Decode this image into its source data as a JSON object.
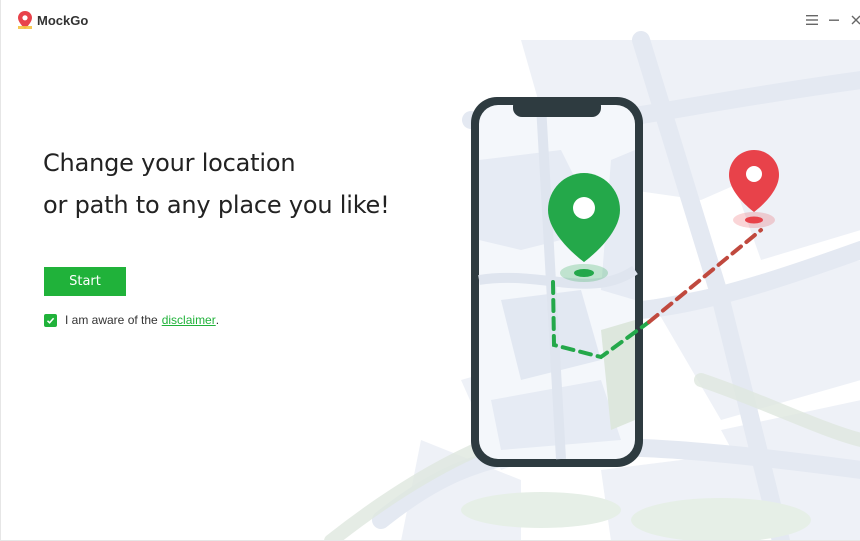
{
  "app": {
    "title": "MockGo"
  },
  "window_controls": {
    "menu_icon": "menu-icon",
    "minimize_icon": "minimize-icon",
    "close_icon": "close-icon"
  },
  "hero": {
    "line1": "Change your location",
    "line2": "or path to any place you like!"
  },
  "actions": {
    "start_label": "Start"
  },
  "disclaimer": {
    "checked": true,
    "prefix": "I am aware of the",
    "link_text": "disclaimer",
    "suffix": "."
  },
  "colors": {
    "accent": "#20b23a",
    "pin_green": "#24a84a",
    "pin_red": "#e8424a",
    "phone_frame": "#2e3b40"
  }
}
